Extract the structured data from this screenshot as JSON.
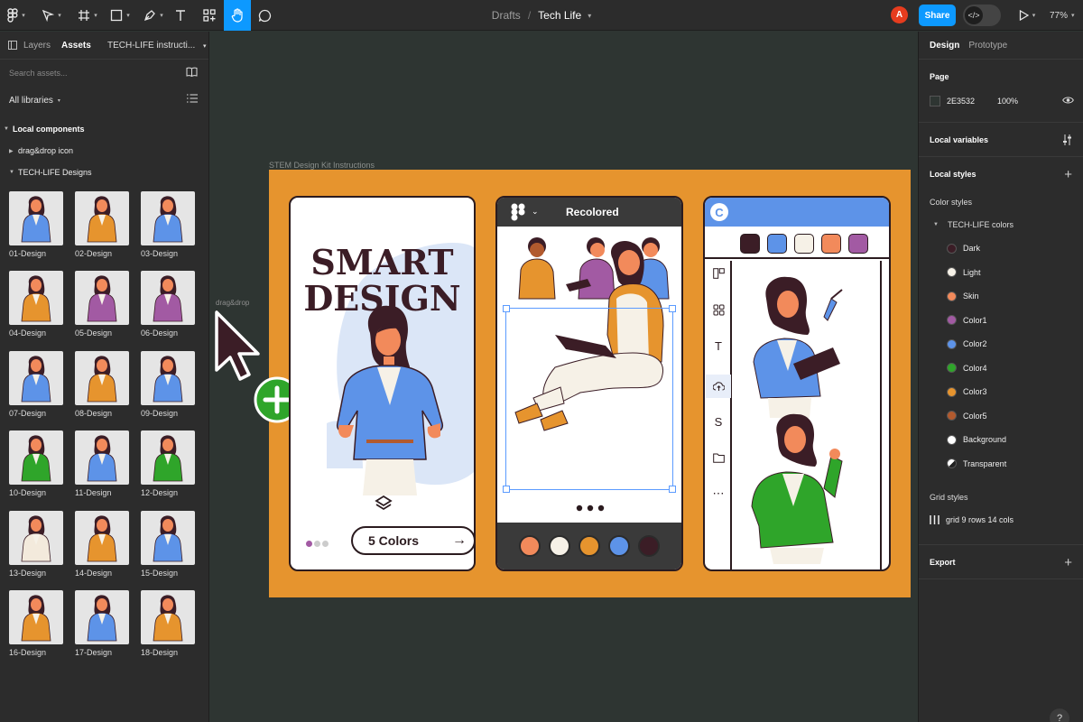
{
  "toolbar": {
    "breadcrumb_parent": "Drafts",
    "breadcrumb_sep": "/",
    "file_name": "Tech Life",
    "avatar_initial": "A",
    "share_label": "Share",
    "dev_mode_icon": "code-icon",
    "zoom": "77%",
    "icons": [
      "figma-menu-icon",
      "move-icon",
      "frame-icon",
      "shape-icon",
      "pen-icon",
      "text-icon",
      "resources-icon",
      "hand-icon",
      "comment-icon"
    ]
  },
  "left_panel": {
    "tab_layers": "Layers",
    "tab_assets": "Assets",
    "library_name": "TECH-LIFE instructi...",
    "search_placeholder": "Search assets...",
    "all_libraries": "All libraries",
    "local_components": "Local components",
    "drag_drop_group": "drag&drop icon",
    "designs_group": "TECH-LIFE Designs",
    "components": [
      "01-Design",
      "02-Design",
      "03-Design",
      "04-Design",
      "05-Design",
      "06-Design",
      "07-Design",
      "08-Design",
      "09-Design",
      "10-Design",
      "11-Design",
      "12-Design",
      "13-Design",
      "14-Design",
      "15-Design",
      "16-Design",
      "17-Design",
      "18-Design"
    ],
    "component_colors": [
      "#5d93e8",
      "#e6942e",
      "#5d93e8",
      "#e6942e",
      "#a25aa3",
      "#a25aa3",
      "#5d93e8",
      "#e6942e",
      "#5d93e8",
      "#2fa52a",
      "#5d93e8",
      "#2fa52a",
      "#f3eadc",
      "#e6942e",
      "#5d93e8",
      "#e6942e",
      "#5d93e8",
      "#e6942e",
      "#3b2b2b",
      "#2fa52a",
      "#5d93e8"
    ]
  },
  "canvas": {
    "frame_label": "STEM Design Kit Instructions",
    "drag_label": "drag&drop",
    "phone1": {
      "headline_1": "SMART",
      "headline_2": "DESIGN",
      "cta": "5 Colors",
      "cta_arrow": "→"
    },
    "phone2": {
      "title": "Recolored",
      "swatches": [
        "#f28a5b",
        "#f6f1e7",
        "#e6942e",
        "#5d93e8",
        "#3b1d26"
      ]
    },
    "phone3": {
      "logo": "C",
      "swatches": [
        "#3b1d26",
        "#5d93e8",
        "#f6f1e7",
        "#f28a5b",
        "#a25aa3"
      ]
    }
  },
  "right_panel": {
    "tab_design": "Design",
    "tab_prototype": "Prototype",
    "page_title": "Page",
    "page_color": "2E3532",
    "page_opacity": "100%",
    "local_variables": "Local variables",
    "local_styles": "Local styles",
    "color_styles": "Color styles",
    "color_group": "TECH-LIFE colors",
    "colors": [
      {
        "name": "Dark",
        "hex": "#3b1d26"
      },
      {
        "name": "Light",
        "hex": "#f6f1e7"
      },
      {
        "name": "Skin",
        "hex": "#f28a5b"
      },
      {
        "name": "Color1",
        "hex": "#a25aa3"
      },
      {
        "name": "Color2",
        "hex": "#5d93e8"
      },
      {
        "name": "Color4",
        "hex": "#2fa52a"
      },
      {
        "name": "Color3",
        "hex": "#e6942e"
      },
      {
        "name": "Color5",
        "hex": "#b25a2e"
      },
      {
        "name": "Background",
        "hex": "#ffffff"
      },
      {
        "name": "Transparent",
        "hex": "transparent"
      }
    ],
    "grid_styles": "Grid styles",
    "grid_name": "grid 9 rows 14 cols",
    "export": "Export",
    "help": "?"
  }
}
